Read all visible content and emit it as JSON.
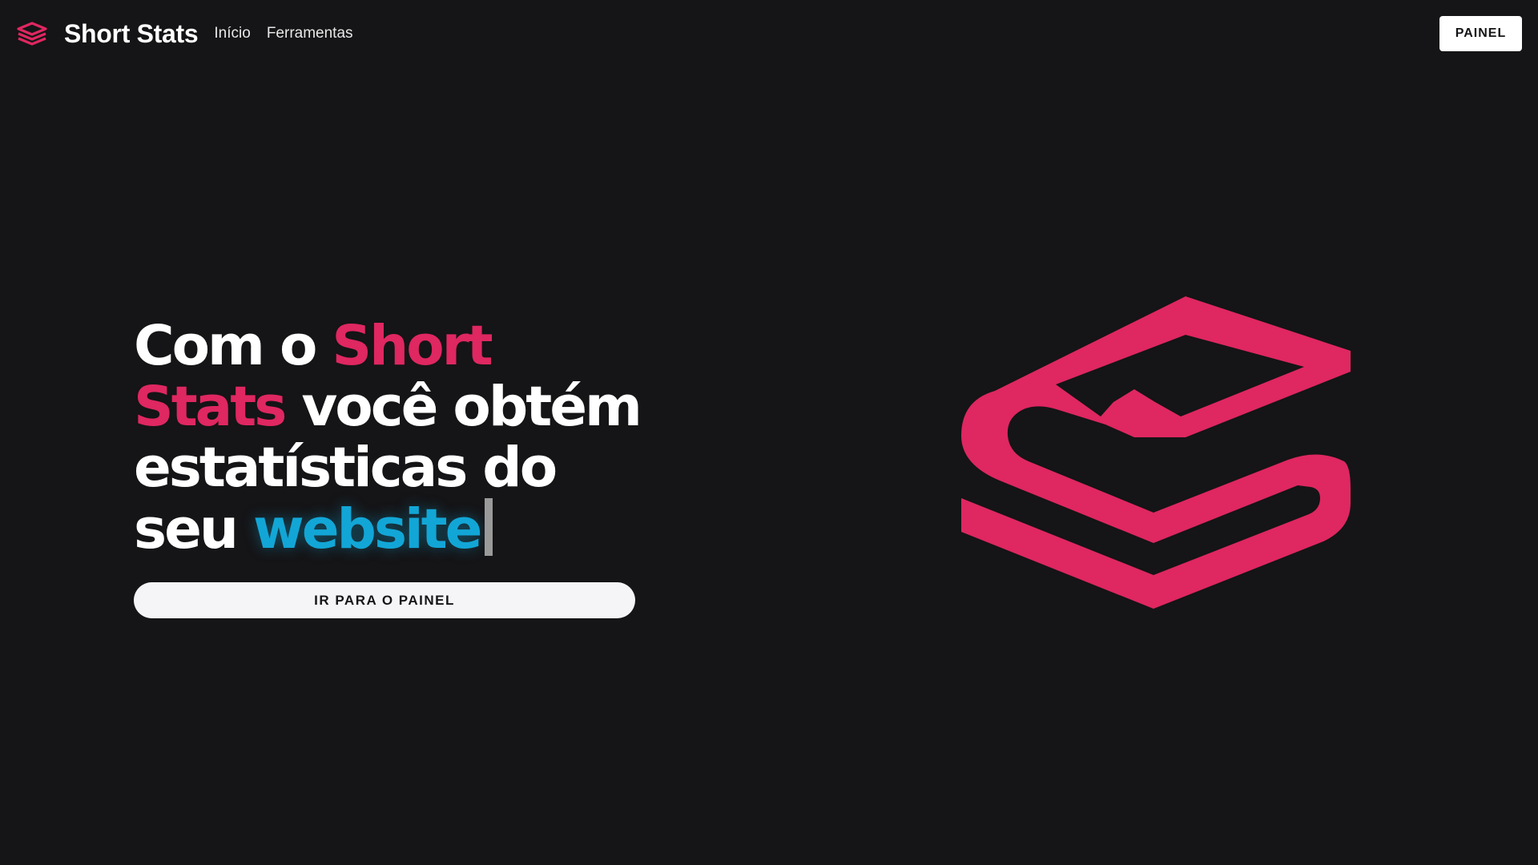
{
  "navbar": {
    "brand_name": "Short Stats",
    "brand_icon": "short-stats-logo-icon",
    "links": [
      {
        "label": "Início"
      },
      {
        "label": "Ferramentas"
      }
    ],
    "cta_label": "PAINEL"
  },
  "hero": {
    "headline": {
      "part1": "Com o ",
      "brand_word": "Short Stats",
      "part2": " você obtém estatísticas do seu ",
      "accent_word": "website"
    },
    "cta_label": "IR PARA O PAINEL",
    "illustration_icon": "short-stats-logo-icon"
  },
  "colors": {
    "background": "#151416",
    "brand": "#df2761",
    "accent": "#12a6d6",
    "button_bg": "#ffffff"
  }
}
